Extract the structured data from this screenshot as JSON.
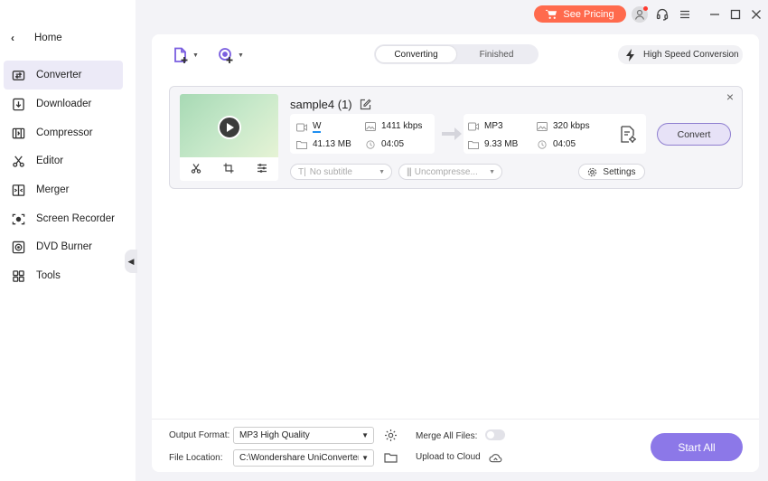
{
  "titlebar": {
    "pricing_label": "See Pricing"
  },
  "sidebar": {
    "home_label": "Home",
    "items": [
      {
        "label": "Converter",
        "icon": "converter-icon",
        "active": true
      },
      {
        "label": "Downloader",
        "icon": "downloader-icon"
      },
      {
        "label": "Compressor",
        "icon": "compressor-icon"
      },
      {
        "label": "Editor",
        "icon": "editor-icon"
      },
      {
        "label": "Merger",
        "icon": "merger-icon"
      },
      {
        "label": "Screen Recorder",
        "icon": "screen-recorder-icon"
      },
      {
        "label": "DVD Burner",
        "icon": "dvd-burner-icon"
      },
      {
        "label": "Tools",
        "icon": "tools-icon"
      }
    ]
  },
  "toolbar": {
    "tabs": [
      {
        "label": "Converting",
        "active": true
      },
      {
        "label": "Finished",
        "active": false
      }
    ],
    "high_speed_label": "High Speed Conversion"
  },
  "file": {
    "name": "sample4 (1)",
    "source": {
      "format": "W",
      "size": "41.13 MB",
      "bitrate": "1411 kbps",
      "duration": "04:05"
    },
    "target": {
      "format": "MP3",
      "size": "9.33 MB",
      "bitrate": "320 kbps",
      "duration": "04:05"
    },
    "convert_label": "Convert",
    "subtitle_placeholder": "No subtitle",
    "audio_placeholder": "Uncompresse...",
    "settings_label": "Settings"
  },
  "bottom": {
    "output_format_label": "Output Format:",
    "output_format_value": "MP3 High Quality",
    "file_location_label": "File Location:",
    "file_location_value": "C:\\Wondershare UniConverter 1",
    "merge_label": "Merge All Files:",
    "upload_label": "Upload to Cloud",
    "start_all_label": "Start All"
  },
  "colors": {
    "accent": "#8c78e8",
    "pricing": "#ff6a4d",
    "sidebar_active": "#eceaf7"
  }
}
